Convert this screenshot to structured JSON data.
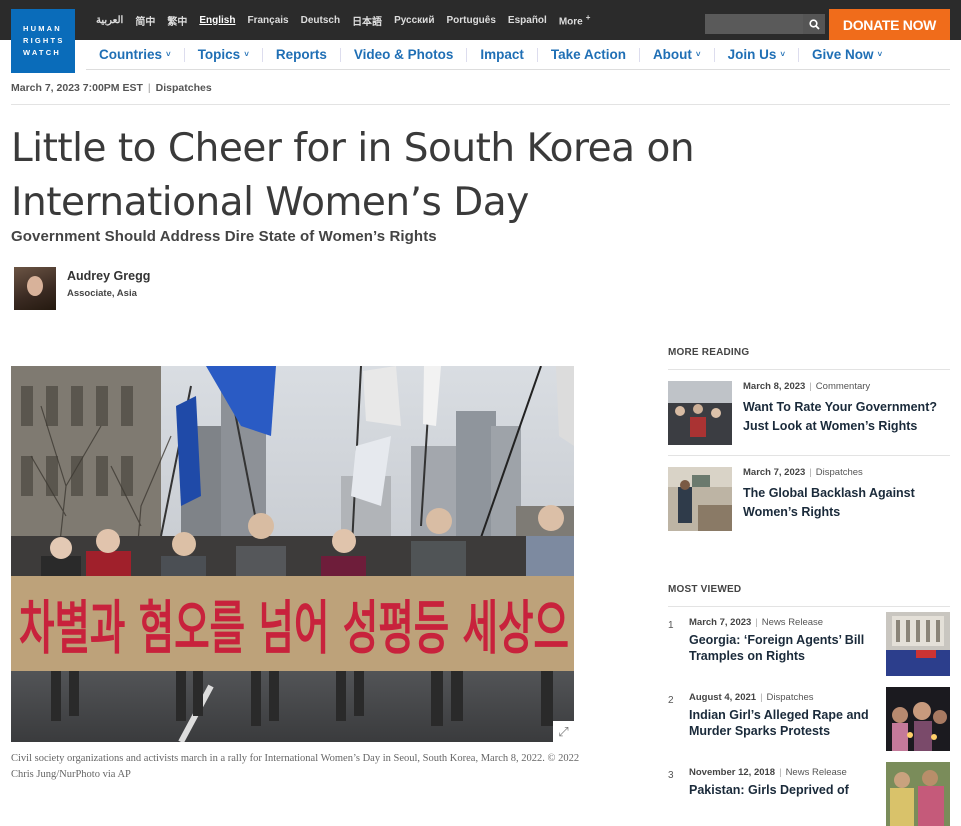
{
  "brand": {
    "logo_lines": [
      "HUMAN",
      "RIGHTS",
      "WATCH"
    ],
    "accent": "#0a6cba",
    "donate_color": "#f06c1b",
    "nav_color": "#1f6fb5"
  },
  "languages": [
    "العربية",
    "简中",
    "繁中",
    "English",
    "Français",
    "Deutsch",
    "日本語",
    "Русский",
    "Português",
    "Español"
  ],
  "languages_more": "More",
  "search": {
    "placeholder": ""
  },
  "donate_label": "DONATE NOW",
  "nav": [
    {
      "label": "Countries",
      "dropdown": true
    },
    {
      "label": "Topics",
      "dropdown": true
    },
    {
      "label": "Reports",
      "dropdown": false
    },
    {
      "label": "Video & Photos",
      "dropdown": false
    },
    {
      "label": "Impact",
      "dropdown": false
    },
    {
      "label": "Take Action",
      "dropdown": false
    },
    {
      "label": "About",
      "dropdown": true
    },
    {
      "label": "Join Us",
      "dropdown": true
    },
    {
      "label": "Give Now",
      "dropdown": true
    }
  ],
  "article": {
    "date": "March 7, 2023 7:00PM EST",
    "type": "Dispatches",
    "title": "Little to Cheer for in South Korea on International Women’s Day",
    "subtitle": "Government Should Address Dire State of Women’s Rights",
    "author_name": "Audrey Gregg",
    "author_role": "Associate, Asia",
    "banner_text": "차별과 혐오를 넘어 성평등 세상으",
    "caption": "Civil society organizations and activists march in a rally for International Women’s Day in Seoul, South Korea, March 8, 2022. © 2022 Chris Jung/NurPhoto via AP"
  },
  "more_reading": {
    "heading": "MORE READING",
    "items": [
      {
        "date": "March 8, 2023",
        "type": "Commentary",
        "title": "Want To Rate Your Government? Just Look at Women’s Rights"
      },
      {
        "date": "March 7, 2023",
        "type": "Dispatches",
        "title": "The Global Backlash Against Women’s Rights"
      }
    ]
  },
  "most_viewed": {
    "heading": "MOST VIEWED",
    "items": [
      {
        "num": "1",
        "date": "March 7, 2023",
        "type": "News Release",
        "title": "Georgia: ‘Foreign Agents’ Bill Tramples on Rights"
      },
      {
        "num": "2",
        "date": "August 4, 2021",
        "type": "Dispatches",
        "title": "Indian Girl’s Alleged Rape and Murder Sparks Protests"
      },
      {
        "num": "3",
        "date": "November 12, 2018",
        "type": "News Release",
        "title": "Pakistan: Girls Deprived of"
      }
    ]
  }
}
